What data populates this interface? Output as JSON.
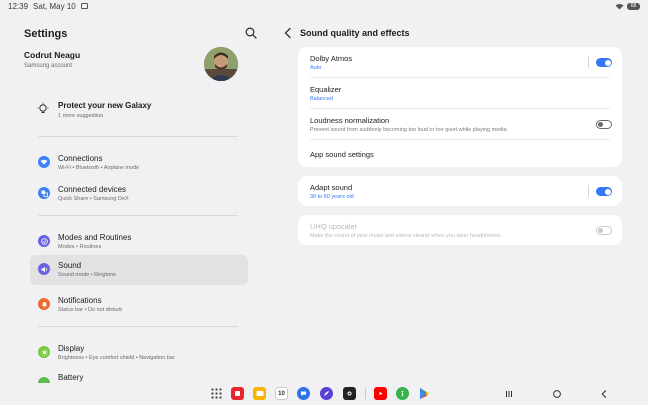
{
  "status_bar": {
    "time": "12:39",
    "date": "Sat, May 10",
    "battery": "68"
  },
  "left_pane": {
    "title": "Settings",
    "profile": {
      "name": "Codrut Neagu",
      "subtitle": "Samsung account"
    },
    "promo": {
      "title": "Protect your new Galaxy",
      "subtitle": "1 more suggestion"
    },
    "items": [
      {
        "title": "Connections",
        "subtitle": "Wi-Fi  •  Bluetooth  •  Airplane mode",
        "icon": "wifi-icon",
        "color": "#3c82f6"
      },
      {
        "title": "Connected devices",
        "subtitle": "Quick Share  •  Samsung DeX",
        "icon": "connected-devices-icon",
        "color": "#3c82f6"
      },
      {
        "title": "Modes and Routines",
        "subtitle": "Modes  •  Routines",
        "icon": "check-circle-icon",
        "color": "#6b64e0"
      },
      {
        "title": "Sound",
        "subtitle": "Sound mode  •  Ringtone",
        "icon": "volume-icon",
        "color": "#6b64e0"
      },
      {
        "title": "Notifications",
        "subtitle": "Status bar  •  Do not disturb",
        "icon": "bell-icon",
        "color": "#ee6a2e"
      },
      {
        "title": "Display",
        "subtitle": "Brightness  •  Eye comfort shield  •  Navigation bar",
        "icon": "sun-icon",
        "color": "#78c83c"
      },
      {
        "title": "Battery",
        "subtitle": "",
        "icon": "battery-icon",
        "color": "#5cbf4a"
      }
    ]
  },
  "right_pane": {
    "title": "Sound quality and effects",
    "card1": {
      "dolby": {
        "label": "Dolby Atmos",
        "value": "Auto",
        "toggle": "on"
      },
      "equalizer": {
        "label": "Equalizer",
        "value": "Balanced"
      },
      "loudness": {
        "label": "Loudness normalization",
        "description": "Prevent sound from suddenly becoming too loud or too quiet while playing media.",
        "toggle": "off"
      },
      "app_sound": {
        "label": "App sound settings"
      }
    },
    "card2": {
      "adapt": {
        "label": "Adapt sound",
        "value": "30 to 60 years old",
        "toggle": "on"
      }
    },
    "card3": {
      "uhq": {
        "label": "UHQ upscaler",
        "description": "Make the sound of your music and videos clearer when you wear headphones.",
        "toggle": "disabled"
      }
    }
  },
  "taskbar": {
    "apps": [
      "apps-grid-icon",
      "app-red-icon",
      "notes-icon",
      "calendar-icon",
      "messages-icon",
      "feather-app-icon",
      "camera-icon",
      "youtube-icon",
      "info-app-icon",
      "play-store-icon"
    ],
    "calendar_day": "10",
    "nav": [
      "recents-icon",
      "home-icon",
      "back-icon"
    ]
  },
  "colors": {
    "accent": "#3478f6",
    "background": "#f1f1f3",
    "card": "#ffffff"
  }
}
